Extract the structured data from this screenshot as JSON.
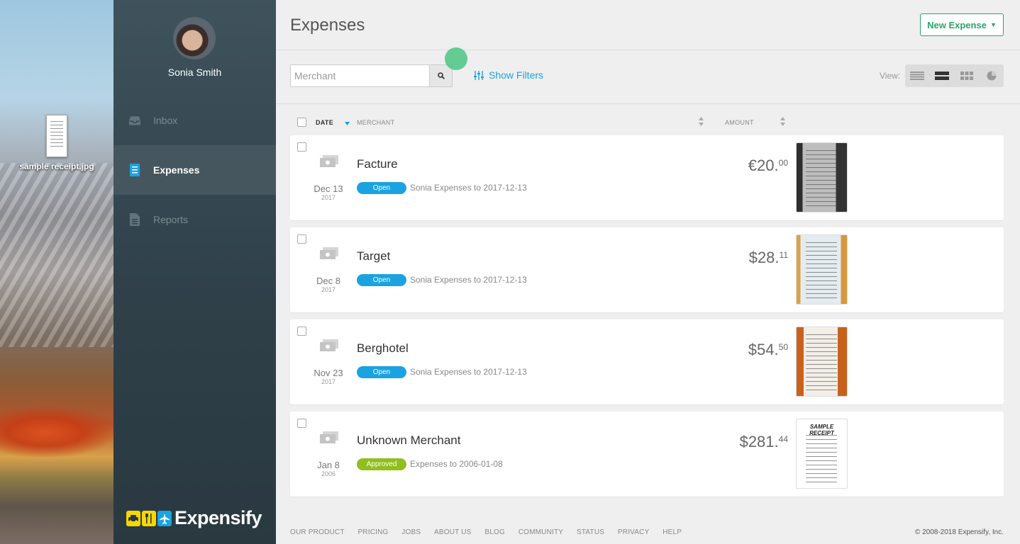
{
  "desktop": {
    "file_label": "sample receipt.jpg"
  },
  "sidebar": {
    "user_name": "Sonia Smith",
    "items": [
      {
        "label": "Inbox",
        "icon": "inbox-icon",
        "active": false
      },
      {
        "label": "Expenses",
        "icon": "expenses-icon",
        "active": true
      },
      {
        "label": "Reports",
        "icon": "reports-icon",
        "active": false
      }
    ],
    "logo_text": "Expensify"
  },
  "header": {
    "title": "Expenses",
    "new_expense_label": "New Expense"
  },
  "toolbar": {
    "search_placeholder": "Merchant",
    "show_filters_label": "Show Filters",
    "view_label": "View:",
    "view_modes": [
      "table-view-icon",
      "list-view-icon",
      "grid-view-icon",
      "chart-view-icon"
    ],
    "active_view": "list-view-icon"
  },
  "table": {
    "columns": {
      "date": "DATE",
      "merchant": "MERCHANT",
      "amount": "AMOUNT"
    },
    "rows": [
      {
        "date": "Dec 13",
        "year": "2017",
        "merchant": "Facture",
        "status": "Open",
        "report": "Sonia Expenses to 2017-12-13",
        "currency": "€",
        "amount_whole": "20.",
        "amount_cents": "00"
      },
      {
        "date": "Dec 8",
        "year": "2017",
        "merchant": "Target",
        "status": "Open",
        "report": "Sonia Expenses to 2017-12-13",
        "currency": "$",
        "amount_whole": "28.",
        "amount_cents": "11"
      },
      {
        "date": "Nov 23",
        "year": "2017",
        "merchant": "Berghotel",
        "status": "Open",
        "report": "Sonia Expenses to 2017-12-13",
        "currency": "$",
        "amount_whole": "54.",
        "amount_cents": "50"
      },
      {
        "date": "Jan 8",
        "year": "2006",
        "merchant": "Unknown Merchant",
        "status": "Approved",
        "report": "Expenses to 2006-01-08",
        "currency": "$",
        "amount_whole": "281.",
        "amount_cents": "44",
        "receipt_title": "SAMPLE RECEIPT"
      }
    ]
  },
  "footer": {
    "links": [
      "OUR PRODUCT",
      "PRICING",
      "JOBS",
      "ABOUT US",
      "BLOG",
      "COMMUNITY",
      "STATUS",
      "PRIVACY",
      "HELP"
    ],
    "copyright": "© 2008-2018 Expensify, Inc."
  },
  "colors": {
    "accent": "#1aa3e0",
    "primary_button": "#2aa56b",
    "approved": "#8fbf1e",
    "sidebar": "#2f4049"
  }
}
